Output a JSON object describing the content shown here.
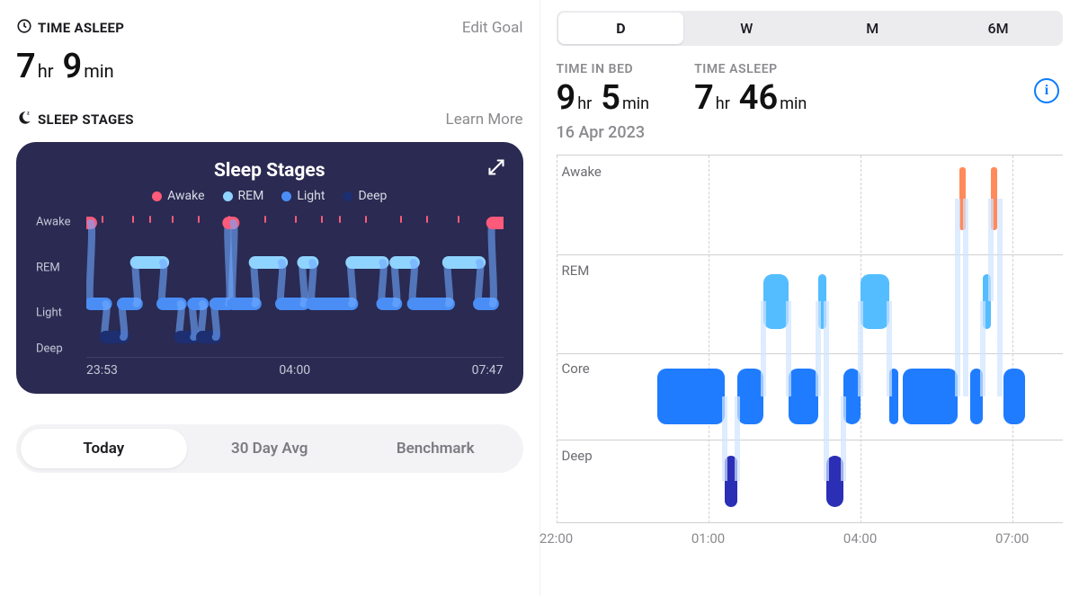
{
  "left": {
    "time_asleep_label": "TIME ASLEEP",
    "edit_goal": "Edit Goal",
    "asleep_hours": "7",
    "asleep_hr_unit": "hr",
    "asleep_minutes": "9",
    "asleep_min_unit": "min",
    "sleep_stages_label": "SLEEP STAGES",
    "learn_more": "Learn More",
    "card_title": "Sleep Stages",
    "legend": {
      "awake": "Awake",
      "rem": "REM",
      "light": "Light",
      "deep": "Deep"
    },
    "y_labels": [
      "Awake",
      "REM",
      "Light",
      "Deep"
    ],
    "x_ticks": [
      "23:53",
      "04:00",
      "07:47"
    ],
    "segmented": [
      "Today",
      "30 Day Avg",
      "Benchmark"
    ],
    "segmented_active": 0
  },
  "right": {
    "ranges": [
      "D",
      "W",
      "M",
      "6M"
    ],
    "range_active": 0,
    "time_in_bed_label": "TIME IN BED",
    "tib_hours": "9",
    "tib_min": "5",
    "time_asleep_label": "TIME ASLEEP",
    "ta_hours": "7",
    "ta_min": "46",
    "hr_unit": "hr",
    "min_unit": "min",
    "date": "16 Apr 2023",
    "row_labels": [
      "Awake",
      "REM",
      "Core",
      "Deep"
    ],
    "x_ticks": [
      "22:00",
      "01:00",
      "04:00",
      "07:00"
    ]
  },
  "chart_data": [
    {
      "type": "area",
      "title": "Sleep Stages",
      "x_range": [
        "23:53",
        "07:47"
      ],
      "categories": [
        "Awake",
        "REM",
        "Light",
        "Deep"
      ],
      "legend": [
        "Awake",
        "REM",
        "Light",
        "Deep"
      ],
      "colors": {
        "Awake": "#ff5a7a",
        "REM": "#8fd3ff",
        "Light": "#4a8ef5",
        "Deep": "#1d2f70"
      },
      "segments": [
        {
          "stage": "Awake",
          "start": "23:53",
          "end": "23:58"
        },
        {
          "stage": "Light",
          "start": "23:58",
          "end": "00:15"
        },
        {
          "stage": "Deep",
          "start": "00:15",
          "end": "00:35"
        },
        {
          "stage": "Light",
          "start": "00:35",
          "end": "00:50"
        },
        {
          "stage": "REM",
          "start": "00:50",
          "end": "01:20"
        },
        {
          "stage": "Light",
          "start": "01:20",
          "end": "01:40"
        },
        {
          "stage": "Deep",
          "start": "01:40",
          "end": "01:55"
        },
        {
          "stage": "Light",
          "start": "01:55",
          "end": "02:05"
        },
        {
          "stage": "Deep",
          "start": "02:05",
          "end": "02:20"
        },
        {
          "stage": "Light",
          "start": "02:20",
          "end": "02:35"
        },
        {
          "stage": "Awake",
          "start": "02:35",
          "end": "02:40"
        },
        {
          "stage": "Light",
          "start": "02:40",
          "end": "03:05"
        },
        {
          "stage": "REM",
          "start": "03:05",
          "end": "03:35"
        },
        {
          "stage": "Light",
          "start": "03:35",
          "end": "04:00"
        },
        {
          "stage": "REM",
          "start": "04:00",
          "end": "04:10"
        },
        {
          "stage": "Light",
          "start": "04:10",
          "end": "04:55"
        },
        {
          "stage": "REM",
          "start": "04:55",
          "end": "05:30"
        },
        {
          "stage": "Light",
          "start": "05:30",
          "end": "05:45"
        },
        {
          "stage": "REM",
          "start": "05:45",
          "end": "06:05"
        },
        {
          "stage": "Light",
          "start": "06:05",
          "end": "06:45"
        },
        {
          "stage": "REM",
          "start": "06:45",
          "end": "07:20"
        },
        {
          "stage": "Light",
          "start": "07:20",
          "end": "07:35"
        },
        {
          "stage": "Awake",
          "start": "07:35",
          "end": "07:47"
        }
      ],
      "awake_ticks": [
        "00:10",
        "00:45",
        "01:05",
        "01:30",
        "02:00",
        "02:35",
        "03:15",
        "03:50",
        "04:20",
        "04:40",
        "05:10",
        "05:50",
        "06:20",
        "06:55"
      ]
    },
    {
      "type": "area",
      "title": "Sleep (Day)",
      "x_range": [
        "22:00",
        "08:00"
      ],
      "categories": [
        "Awake",
        "REM",
        "Core",
        "Deep"
      ],
      "colors": {
        "Awake": "#ff8a5c",
        "REM": "#54bdff",
        "Core": "#1f7cff",
        "Deep": "#2b2fb5"
      },
      "date": "16 Apr 2023",
      "segments": [
        {
          "stage": "Core",
          "start": "00:00",
          "end": "01:20"
        },
        {
          "stage": "Deep",
          "start": "01:20",
          "end": "01:35"
        },
        {
          "stage": "Core",
          "start": "01:35",
          "end": "02:05"
        },
        {
          "stage": "REM",
          "start": "02:05",
          "end": "02:35"
        },
        {
          "stage": "Core",
          "start": "02:35",
          "end": "03:10"
        },
        {
          "stage": "REM",
          "start": "03:10",
          "end": "03:20"
        },
        {
          "stage": "Deep",
          "start": "03:20",
          "end": "03:40"
        },
        {
          "stage": "Core",
          "start": "03:40",
          "end": "04:00"
        },
        {
          "stage": "REM",
          "start": "04:00",
          "end": "04:35"
        },
        {
          "stage": "Core",
          "start": "04:35",
          "end": "04:45"
        },
        {
          "stage": "Core",
          "start": "04:50",
          "end": "05:55"
        },
        {
          "stage": "Awake",
          "start": "05:58",
          "end": "06:05"
        },
        {
          "stage": "Core",
          "start": "06:10",
          "end": "06:25"
        },
        {
          "stage": "REM",
          "start": "06:25",
          "end": "06:35"
        },
        {
          "stage": "Awake",
          "start": "06:35",
          "end": "06:45"
        },
        {
          "stage": "Core",
          "start": "06:50",
          "end": "07:15"
        }
      ]
    }
  ]
}
